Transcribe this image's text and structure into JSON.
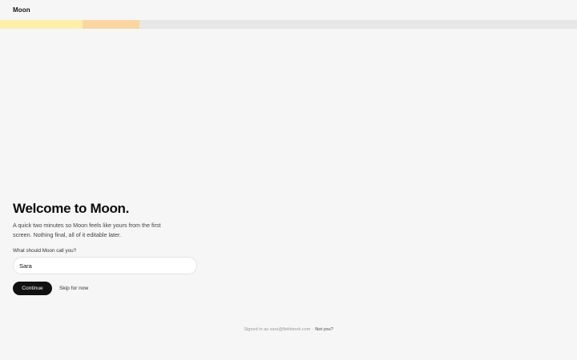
{
  "app": {
    "title": "Moon"
  },
  "progress": {
    "steps": [
      {
        "state": "complete",
        "color": "#fdeeaa",
        "fraction": 0.143
      },
      {
        "state": "current",
        "color": "#fbd6a2",
        "fraction": 0.099
      }
    ],
    "track_color": "#e7e7e7"
  },
  "onboarding": {
    "headline": "Welcome to Moon.",
    "intro": "A quick two minutes so Moon feels like yours from the first screen. Nothing final, all of it editable later.",
    "name_label": "What should Moon call you?",
    "name_value": "Sara",
    "continue_label": "Continue",
    "skip_label": "Skip for now"
  },
  "footer": {
    "signed_in": "Signed in as sara@fieldwork.com",
    "separator": "·",
    "not_you": "Not you?"
  },
  "colors": {
    "background": "#f6f6f6",
    "primary_button": "#111111"
  }
}
